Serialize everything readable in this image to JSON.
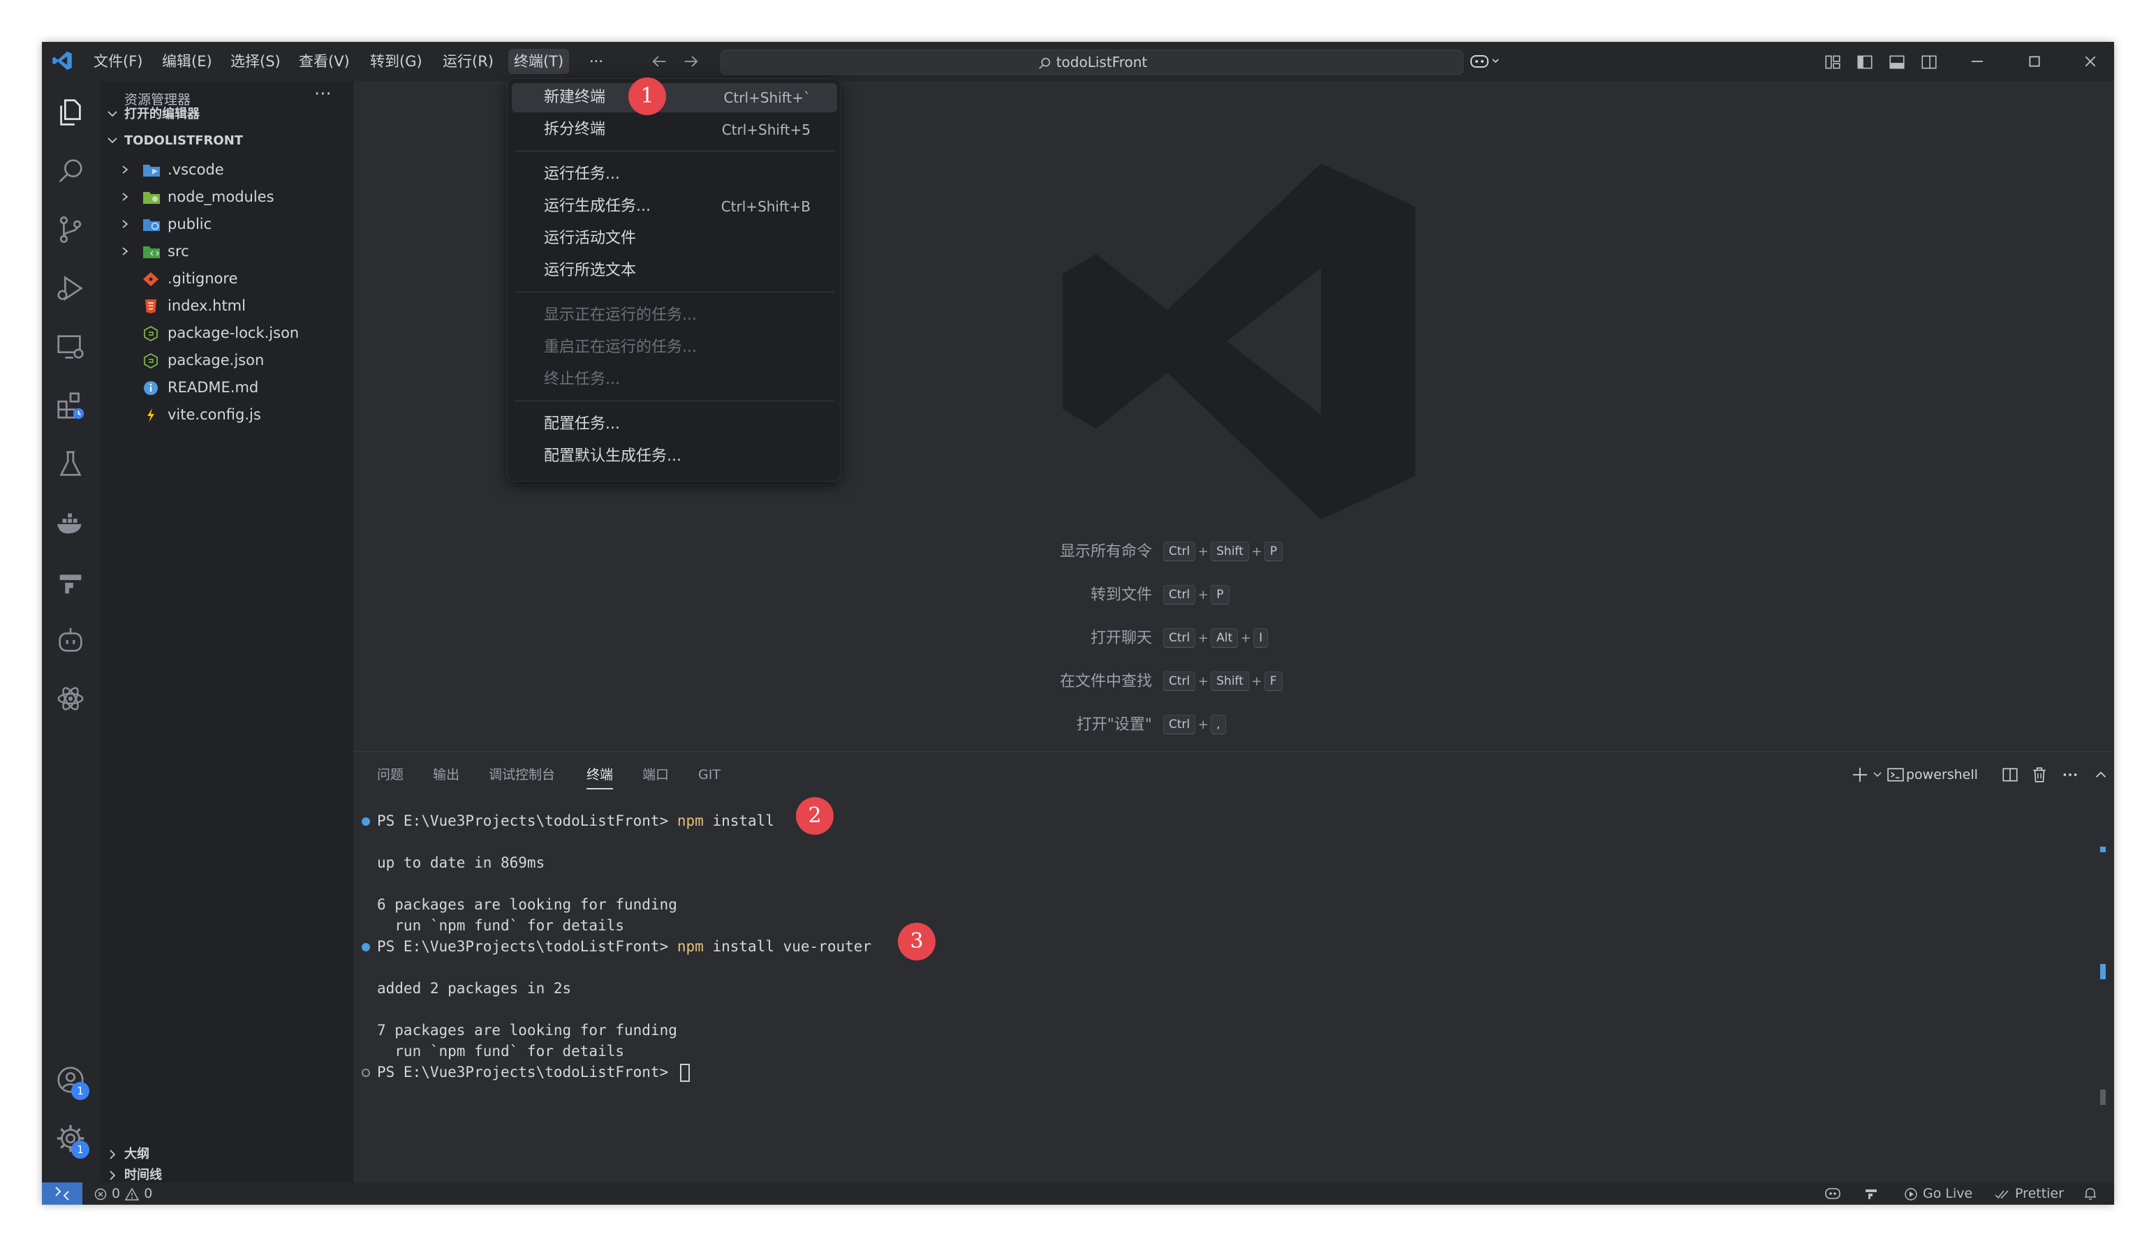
{
  "menubar": [
    {
      "label": "文件(F)"
    },
    {
      "label": "编辑(E)"
    },
    {
      "label": "选择(S)"
    },
    {
      "label": "查看(V)"
    },
    {
      "label": "转到(G)"
    },
    {
      "label": "运行(R)"
    },
    {
      "label": "终端(T)"
    },
    {
      "label": "···"
    }
  ],
  "title": "todoListFront",
  "sidebar": {
    "title": "资源管理器",
    "more": "···",
    "open_editors": "打开的编辑器",
    "project": "TODOLISTFRONT",
    "items": [
      {
        "name": ".vscode",
        "icon": "vscode-folder-icon"
      },
      {
        "name": "node_modules",
        "icon": "node-folder-icon"
      },
      {
        "name": "public",
        "icon": "public-folder-icon"
      },
      {
        "name": "src",
        "icon": "src-folder-icon"
      },
      {
        "name": ".gitignore",
        "icon": "git-icon"
      },
      {
        "name": "index.html",
        "icon": "html-icon"
      },
      {
        "name": "package-lock.json",
        "icon": "node-icon"
      },
      {
        "name": "package.json",
        "icon": "node-icon"
      },
      {
        "name": "README.md",
        "icon": "info-icon"
      },
      {
        "name": "vite.config.js",
        "icon": "vite-icon"
      }
    ],
    "outline": "大纲",
    "timeline": "时间线"
  },
  "terminal_menu": {
    "items": [
      {
        "label": "新建终端",
        "shortcut": "Ctrl+Shift+`"
      },
      {
        "label": "拆分终端",
        "shortcut": "Ctrl+Shift+5"
      },
      {
        "label": "运行任务..."
      },
      {
        "label": "运行生成任务...",
        "shortcut": "Ctrl+Shift+B"
      },
      {
        "label": "运行活动文件"
      },
      {
        "label": "运行所选文本"
      },
      {
        "label": "显示正在运行的任务..."
      },
      {
        "label": "重启正在运行的任务..."
      },
      {
        "label": "终止任务..."
      },
      {
        "label": "配置任务..."
      },
      {
        "label": "配置默认生成任务..."
      }
    ]
  },
  "steps": [
    "1",
    "2",
    "3"
  ],
  "shortcuts": [
    {
      "label": "显示所有命令",
      "keys": [
        "Ctrl",
        "Shift",
        "P"
      ]
    },
    {
      "label": "转到文件",
      "keys": [
        "Ctrl",
        "P"
      ]
    },
    {
      "label": "打开聊天",
      "keys": [
        "Ctrl",
        "Alt",
        "I"
      ]
    },
    {
      "label": "在文件中查找",
      "keys": [
        "Ctrl",
        "Shift",
        "F"
      ]
    },
    {
      "label": "打开\"设置\"",
      "keys": [
        "Ctrl",
        ","
      ]
    }
  ],
  "panel": {
    "tabs": [
      "问题",
      "输出",
      "调试控制台",
      "终端",
      "端口",
      "GIT"
    ],
    "shell": "powershell"
  },
  "terminal": {
    "prompt": "PS E:\\Vue3Projects\\todoListFront> ",
    "cmd_npm": "npm",
    "cmd1_args": " install",
    "out1": "up to date in 869ms",
    "out2": "6 packages are looking for funding",
    "out3": "  run `npm fund` for details",
    "cmd2_args": " install vue-router",
    "out4": "added 2 packages in 2s",
    "out5": "7 packages are looking for funding",
    "out6": "  run `npm fund` for details"
  },
  "status": {
    "errors": "0",
    "warnings": "0",
    "golive": "Go Live",
    "prettier": "Prettier"
  },
  "badges": {
    "accounts": "1",
    "settings": "1"
  },
  "colors": {
    "accent": "#3b82f6",
    "step": "#e6464c",
    "background": "#2b2d31"
  }
}
